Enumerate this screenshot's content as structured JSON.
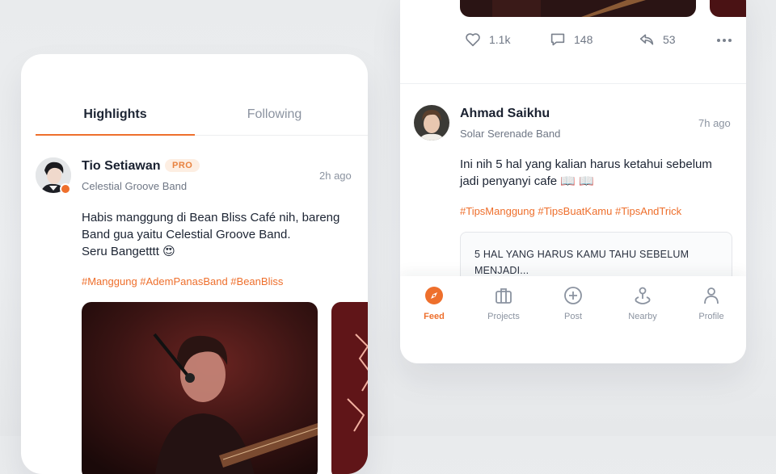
{
  "left_card": {
    "tabs": [
      {
        "label": "Highlights",
        "active": true
      },
      {
        "label": "Following",
        "active": false
      }
    ],
    "post": {
      "author": "Tio Setiawan",
      "badge": "PRO",
      "band": "Celestial Groove Band",
      "time": "2h ago",
      "text_lines": [
        "Habis manggung di Bean Bliss Café nih, bareng",
        "Band gua yaitu Celestial Groove Band.",
        "Seru Bangetttt 😍"
      ],
      "hashtags": "#Manggung #AdemPanasBand #BeanBliss"
    }
  },
  "right_card": {
    "actions": {
      "likes": "1.1k",
      "comments": "148",
      "shares": "53"
    },
    "post": {
      "author": "Ahmad Saikhu",
      "band": "Solar Serenade Band",
      "time": "7h ago",
      "text_lines": [
        "Ini nih 5 hal yang kalian harus ketahui sebelum",
        "jadi penyanyi cafe 📖 📖"
      ],
      "hashtags": "#TipsManggung #TipsBuatKamu #TipsAndTrick",
      "preview_text": "5 HAL YANG HARUS KAMU TAHU SEBELUM MENJADI..."
    },
    "nav": [
      {
        "label": "Feed",
        "icon": "compass-icon",
        "active": true
      },
      {
        "label": "Projects",
        "icon": "briefcase-icon",
        "active": false
      },
      {
        "label": "Post",
        "icon": "plus-circle-icon",
        "active": false
      },
      {
        "label": "Nearby",
        "icon": "map-pin-icon",
        "active": false
      },
      {
        "label": "Profile",
        "icon": "user-icon",
        "active": false
      }
    ]
  },
  "colors": {
    "accent": "#ee6f2c",
    "text": "#1c2433",
    "muted": "#8b93a0",
    "background": "#eaecee"
  }
}
